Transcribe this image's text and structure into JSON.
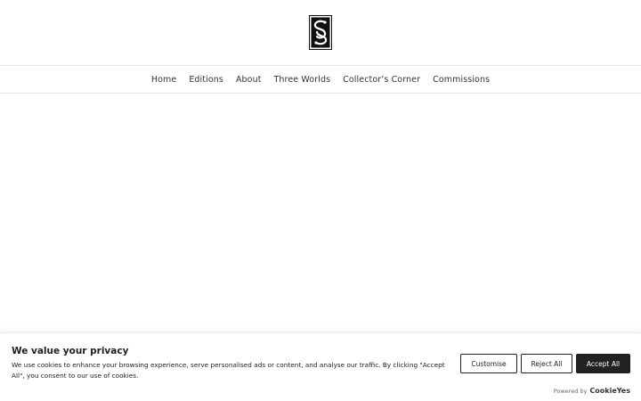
{
  "header": {
    "logo_icon": "ornate-monogram-logo-icon"
  },
  "nav": {
    "items": [
      "Home",
      "Editions",
      "About",
      "Three Worlds",
      "Collector’s Corner",
      "Commissions"
    ]
  },
  "cookie_banner": {
    "title": "We value your privacy",
    "text": "We use cookies to enhance your browsing experience, serve personalised ads or content, and analyse our traffic. By clicking \"Accept All\", you consent to our use of cookies.",
    "customise_label": "Customise",
    "reject_label": "Reject All",
    "accept_label": "Accept All",
    "powered_by_label": "Powered by",
    "powered_by_brand": "CookieYes",
    "colors": {
      "dark": "#212121",
      "light": "#ffffff"
    }
  }
}
